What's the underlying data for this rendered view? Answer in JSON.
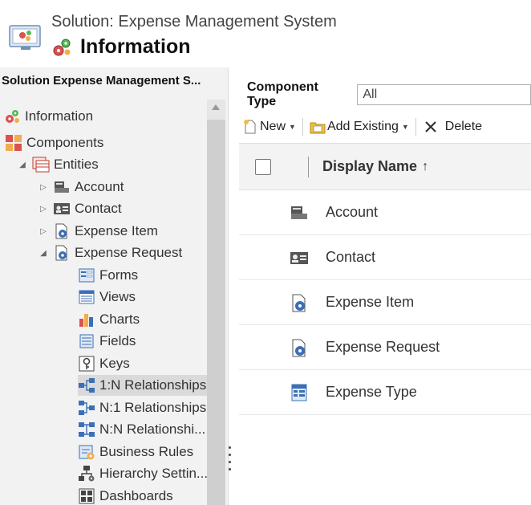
{
  "header": {
    "solution_title": "Solution: Expense Management System",
    "info_title": "Information"
  },
  "left_panel": {
    "solution_label": "Solution Expense Management S...",
    "tree": [
      {
        "label": "Information",
        "icon": "information-gear-icon"
      },
      {
        "label": "Components",
        "icon": "components-icon"
      },
      {
        "label": "Entities",
        "icon": "entities-icon",
        "expanded": true
      },
      {
        "label": "Account",
        "icon": "account-icon",
        "expanded": false
      },
      {
        "label": "Contact",
        "icon": "contact-card-icon",
        "expanded": false
      },
      {
        "label": "Expense Item",
        "icon": "entity-gear-icon",
        "expanded": false
      },
      {
        "label": "Expense Request",
        "icon": "entity-gear-icon",
        "expanded": true
      },
      {
        "label": "Forms",
        "icon": "forms-icon"
      },
      {
        "label": "Views",
        "icon": "views-icon"
      },
      {
        "label": "Charts",
        "icon": "charts-icon"
      },
      {
        "label": "Fields",
        "icon": "fields-icon"
      },
      {
        "label": "Keys",
        "icon": "keys-icon"
      },
      {
        "label": "1:N Relationships",
        "icon": "relationship-icon",
        "selected": true
      },
      {
        "label": "N:1 Relationships",
        "icon": "relationship-icon"
      },
      {
        "label": "N:N Relationshi...",
        "icon": "relationship-icon"
      },
      {
        "label": "Business Rules",
        "icon": "business-rules-icon"
      },
      {
        "label": "Hierarchy Settin...",
        "icon": "hierarchy-icon"
      },
      {
        "label": "Dashboards",
        "icon": "dashboards-icon"
      }
    ]
  },
  "right_panel": {
    "component_type_label": "Component Type",
    "component_type_value": "All",
    "toolbar": {
      "new_label": "New",
      "add_existing_label": "Add Existing",
      "delete_label": "Delete"
    },
    "grid": {
      "column_header": "Display Name",
      "sort_arrow": "↑",
      "rows": [
        {
          "name": "Account",
          "icon": "account-icon"
        },
        {
          "name": "Contact",
          "icon": "contact-card-icon"
        },
        {
          "name": "Expense Item",
          "icon": "entity-gear-icon"
        },
        {
          "name": "Expense Request",
          "icon": "entity-gear-icon"
        },
        {
          "name": "Expense Type",
          "icon": "entity-table-icon"
        }
      ]
    }
  },
  "colors": {
    "panel_bg": "#f2f2f2",
    "selected_bg": "#dadada",
    "grid_header_bg": "#f3f3f3"
  }
}
